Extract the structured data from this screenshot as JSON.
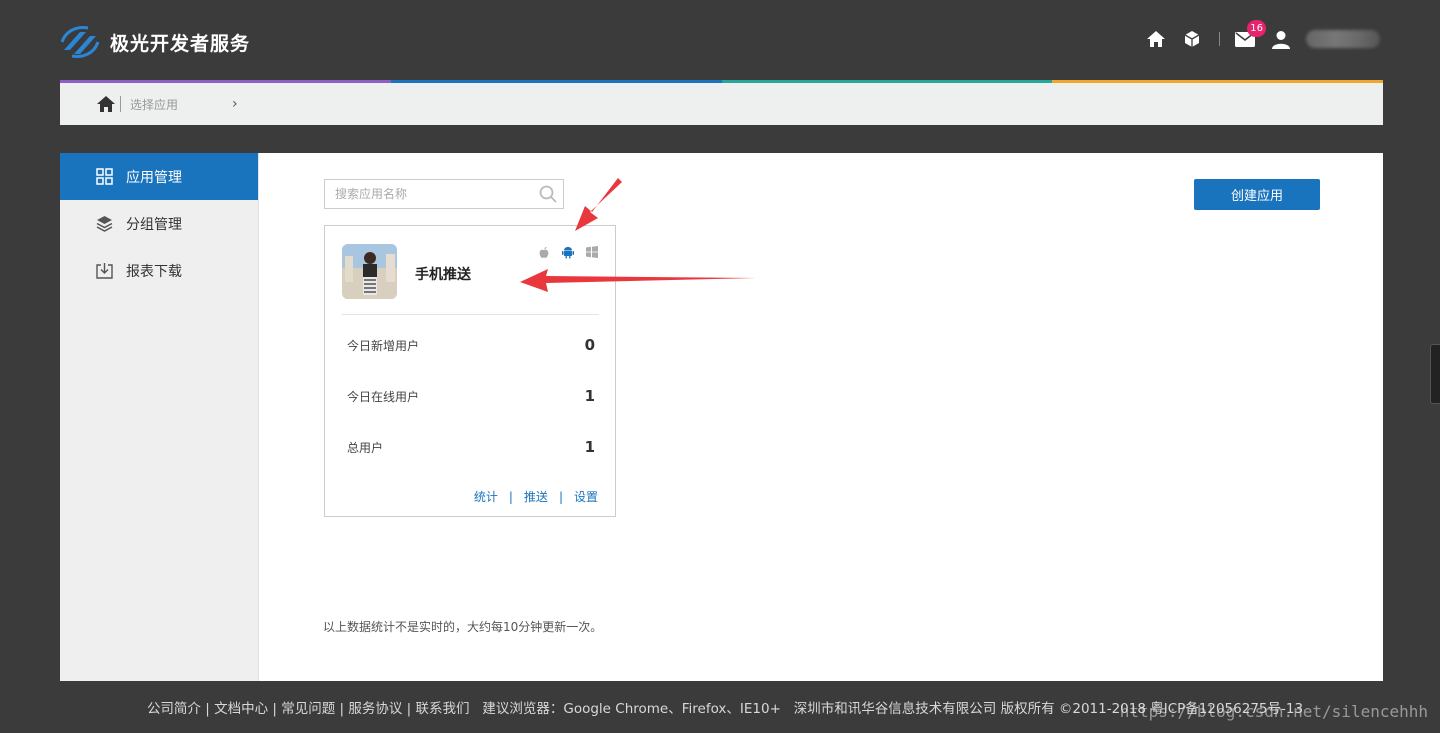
{
  "header": {
    "brand": "极光开发者服务",
    "mail_count": "16"
  },
  "breadcrumb": {
    "label": "选择应用",
    "chevron": "›"
  },
  "color_strip": [
    "#8e5fc6",
    "#1a73bd",
    "#27a69a",
    "#f0a730"
  ],
  "sidebar": {
    "items": [
      {
        "label": "应用管理",
        "icon": "grid-icon",
        "active": true
      },
      {
        "label": "分组管理",
        "icon": "layers-icon",
        "active": false
      },
      {
        "label": "报表下载",
        "icon": "download-icon",
        "active": false
      }
    ]
  },
  "search": {
    "placeholder": "搜索应用名称"
  },
  "create_button": "创建应用",
  "app_card": {
    "name": "手机推送",
    "platforms": [
      "apple-icon",
      "android-icon",
      "windows-icon"
    ],
    "stats": [
      {
        "label": "今日新增用户",
        "value": "0"
      },
      {
        "label": "今日在线用户",
        "value": "1"
      },
      {
        "label": "总用户",
        "value": "1"
      }
    ],
    "links": [
      "统计",
      "推送",
      "设置"
    ]
  },
  "note": "以上数据统计不是实时的，大约每10分钟更新一次。",
  "footer": {
    "links": [
      "公司简介",
      "文档中心",
      "常见问题",
      "服务协议",
      "联系我们"
    ],
    "browsers": "建议浏览器：Google Chrome、Firefox、IE10+",
    "copyright": "深圳市和讯华谷信息技术有限公司 版权所有 ©2011-2018 粤ICP备12056275号-13"
  },
  "watermark": "https://blog.csdn.net/silencehhh",
  "colors": {
    "accent": "#1a73bd",
    "badge": "#e6236c",
    "annotation_arrow": "#e8383d",
    "background": "#3b3b3b"
  }
}
